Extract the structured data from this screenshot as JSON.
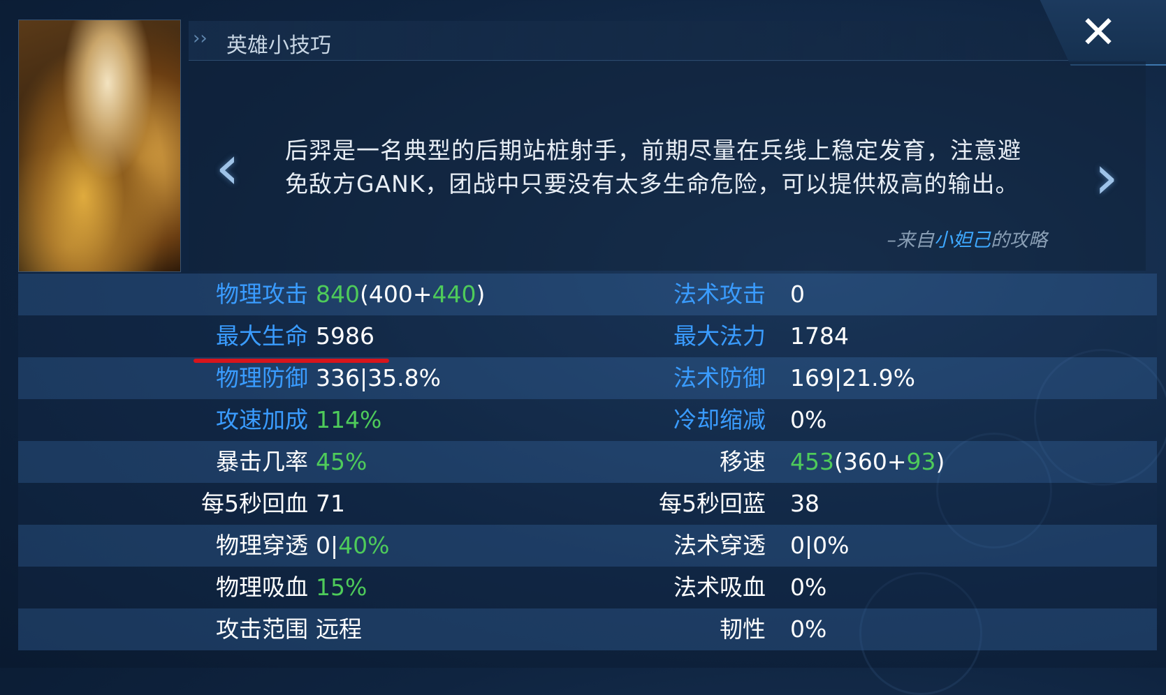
{
  "header": {
    "title": "英雄小技巧",
    "close_icon": "close-icon"
  },
  "tip": {
    "text_line1": "后羿是一名典型的后期站桩射手，前期尽量在兵线上稳定发育，注意避",
    "text_line2": "免敌方GANK，团战中只要没有太多生命危险，可以提供极高的输出。",
    "source_prefix": "–来自",
    "source_author": "小妲己",
    "source_suffix": "的攻略"
  },
  "colors": {
    "label_blue": "#3a9cff",
    "value_green": "#4ecb5a",
    "annotation_red": "#d8151c"
  },
  "stats": [
    {
      "left_label": "物理攻击",
      "left_value": {
        "total": "840",
        "open": "(",
        "base": "400",
        "plus": "+",
        "bonus": "440",
        "close": ")"
      },
      "right_label": "法术攻击",
      "right_value": "0"
    },
    {
      "left_label": "最大生命",
      "left_value": "5986",
      "right_label": "最大法力",
      "right_value": "1784"
    },
    {
      "left_label": "物理防御",
      "left_value": "336|35.8%",
      "right_label": "法术防御",
      "right_value": "169|21.9%"
    },
    {
      "left_label": "攻速加成",
      "left_value": "114%",
      "right_label": "冷却缩减",
      "right_value": "0%"
    },
    {
      "left_label": "暴击几率",
      "left_value": "45%",
      "right_label": "移速",
      "right_value": {
        "total": "453",
        "open": "(",
        "base": "360",
        "plus": "+",
        "bonus": "93",
        "close": ")"
      }
    },
    {
      "left_label": "每5秒回血",
      "left_value": "71",
      "right_label": "每5秒回蓝",
      "right_value": "38"
    },
    {
      "left_label": "物理穿透",
      "left_value": {
        "a": "0|",
        "b": "40%"
      },
      "right_label": "法术穿透",
      "right_value": "0|0%"
    },
    {
      "left_label": "物理吸血",
      "left_value": "15%",
      "right_label": "法术吸血",
      "right_value": "0%"
    },
    {
      "left_label": "攻击范围",
      "left_value": "远程",
      "right_label": "韧性",
      "right_value": "0%"
    }
  ]
}
